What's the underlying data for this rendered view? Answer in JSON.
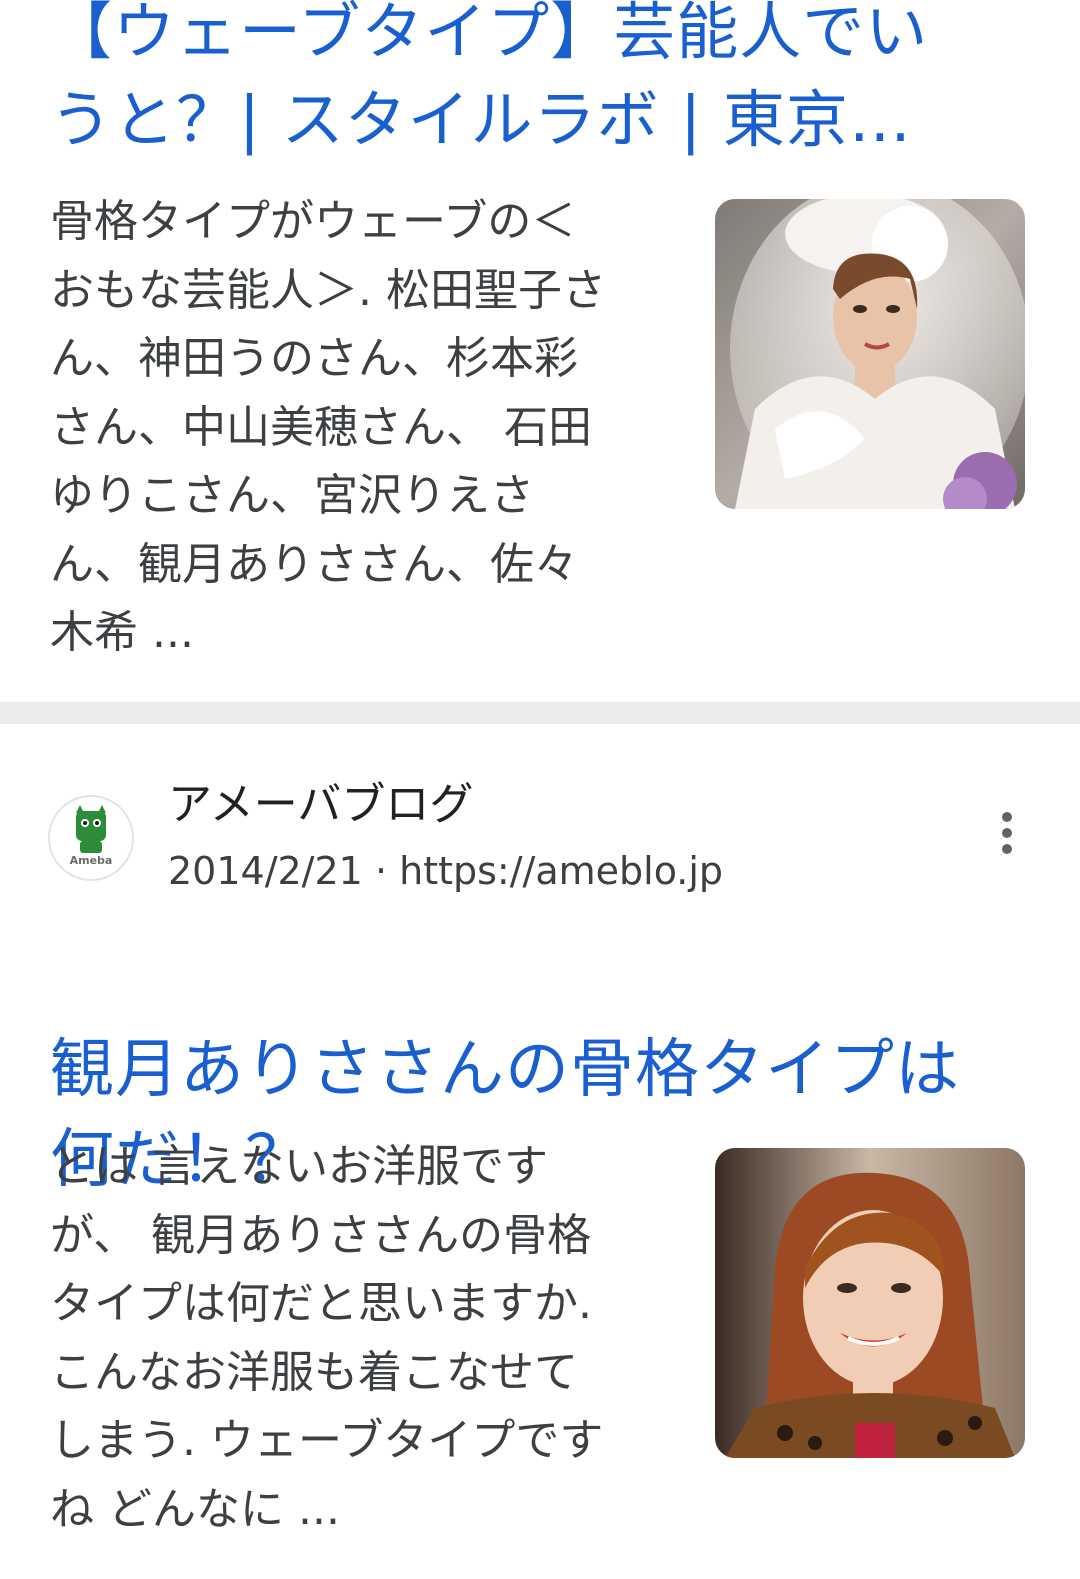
{
  "results": [
    {
      "title_line1": "【ウェーブタイプ】芸能人でい",
      "title_line2": "うと？| スタイルラボ | 東京…",
      "snippet": "骨格タイプがウェーブの＜\nおもな芸能人＞. 松田聖子さ\nん、神田うのさん、杉本彩\nさん、中山美穂さん、 石田\nゆりこさん、宮沢りえさ\nん、観月ありささん、佐々\n木希 ..."
    },
    {
      "site_name": "アメーバブログ",
      "favicon_text": "Ameba",
      "date": "2014/2/21",
      "separator": "·",
      "url": "https://ameblo.jp",
      "title": "観月ありささんの骨格タイプは\n何だ！？",
      "snippet": "とは 言えないお洋服です\nが、 観月ありささんの骨格\nタイプは何だと思いますか.\nこんなお洋服も着こなせて\nしまう. ウェーブタイプです\nね どんなに ..."
    }
  ],
  "colors": {
    "title_link": "#1a5fcf",
    "snippet_text": "#3c4043",
    "divider": "#ebebeb",
    "ameba_green": "#2d8c3a"
  },
  "icons": {
    "more": "more-vert-icon",
    "favicon": "ameba-favicon-icon"
  }
}
